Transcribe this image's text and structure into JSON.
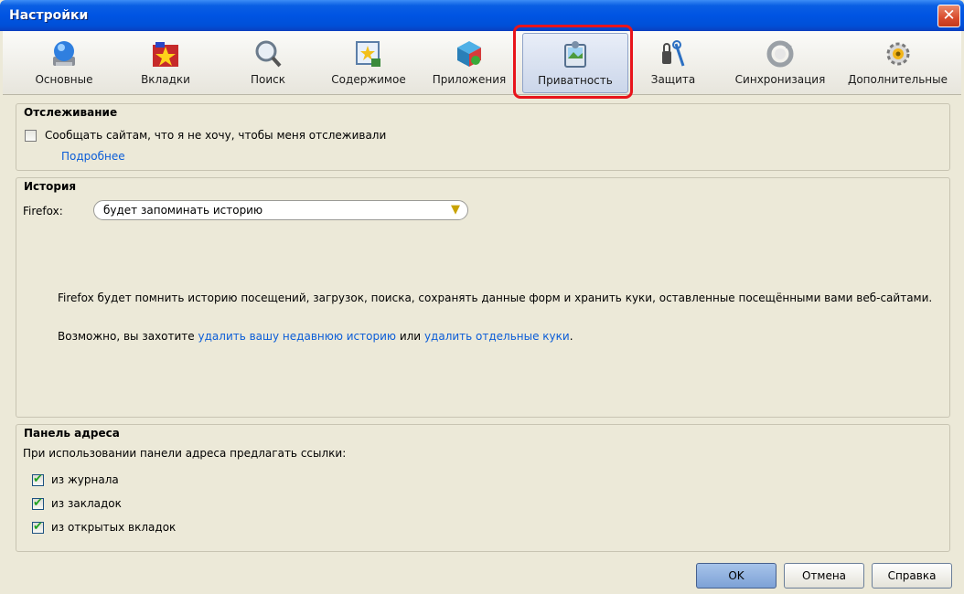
{
  "window": {
    "title": "Настройки"
  },
  "toolbar": {
    "items": [
      {
        "label": "Основные",
        "icon": "general-icon"
      },
      {
        "label": "Вкладки",
        "icon": "tabs-icon"
      },
      {
        "label": "Поиск",
        "icon": "search-icon"
      },
      {
        "label": "Содержимое",
        "icon": "content-icon"
      },
      {
        "label": "Приложения",
        "icon": "applications-icon"
      },
      {
        "label": "Приватность",
        "icon": "privacy-icon",
        "selected": true
      },
      {
        "label": "Защита",
        "icon": "security-icon"
      },
      {
        "label": "Синхронизация",
        "icon": "sync-icon"
      },
      {
        "label": "Дополнительные",
        "icon": "advanced-icon"
      }
    ]
  },
  "tracking": {
    "title": "Отслеживание",
    "dnt_label": "Сообщать сайтам, что я не хочу, чтобы меня отслеживали",
    "dnt_checked": false,
    "learn_more": "Подробнее"
  },
  "history": {
    "title": "История",
    "firefox_label": "Firefox:",
    "mode": "будет запоминать историю",
    "description": "Firefox будет помнить историю посещений, загрузок, поиска, сохранять данные форм и хранить куки, оставленные посещёнными вами веб-сайтами.",
    "hint_prefix": "Возможно, вы захотите",
    "clear_link": "удалить вашу недавнюю историю",
    "hint_or": "или",
    "cookies_link": "удалить отдельные куки",
    "hint_suffix": "."
  },
  "addressbar": {
    "title": "Панель адреса",
    "subtitle": "При использовании панели адреса предлагать ссылки:",
    "options": [
      {
        "label": "из журнала",
        "checked": true
      },
      {
        "label": "из закладок",
        "checked": true
      },
      {
        "label": "из открытых вкладок",
        "checked": true
      }
    ]
  },
  "buttons": {
    "ok": "OK",
    "cancel": "Отмена",
    "help": "Справка"
  },
  "colors": {
    "accent": "#0054e3",
    "highlight": "#e8141b",
    "link": "#0b5dd7"
  }
}
